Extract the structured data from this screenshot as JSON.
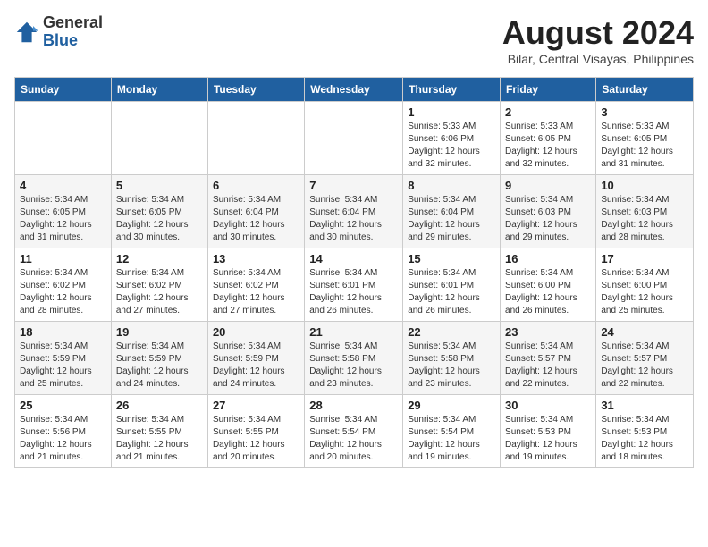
{
  "logo": {
    "text_general": "General",
    "text_blue": "Blue"
  },
  "header": {
    "month": "August 2024",
    "location": "Bilar, Central Visayas, Philippines"
  },
  "weekdays": [
    "Sunday",
    "Monday",
    "Tuesday",
    "Wednesday",
    "Thursday",
    "Friday",
    "Saturday"
  ],
  "weeks": [
    [
      {
        "day": "",
        "info": ""
      },
      {
        "day": "",
        "info": ""
      },
      {
        "day": "",
        "info": ""
      },
      {
        "day": "",
        "info": ""
      },
      {
        "day": "1",
        "info": "Sunrise: 5:33 AM\nSunset: 6:06 PM\nDaylight: 12 hours\nand 32 minutes."
      },
      {
        "day": "2",
        "info": "Sunrise: 5:33 AM\nSunset: 6:05 PM\nDaylight: 12 hours\nand 32 minutes."
      },
      {
        "day": "3",
        "info": "Sunrise: 5:33 AM\nSunset: 6:05 PM\nDaylight: 12 hours\nand 31 minutes."
      }
    ],
    [
      {
        "day": "4",
        "info": "Sunrise: 5:34 AM\nSunset: 6:05 PM\nDaylight: 12 hours\nand 31 minutes."
      },
      {
        "day": "5",
        "info": "Sunrise: 5:34 AM\nSunset: 6:05 PM\nDaylight: 12 hours\nand 30 minutes."
      },
      {
        "day": "6",
        "info": "Sunrise: 5:34 AM\nSunset: 6:04 PM\nDaylight: 12 hours\nand 30 minutes."
      },
      {
        "day": "7",
        "info": "Sunrise: 5:34 AM\nSunset: 6:04 PM\nDaylight: 12 hours\nand 30 minutes."
      },
      {
        "day": "8",
        "info": "Sunrise: 5:34 AM\nSunset: 6:04 PM\nDaylight: 12 hours\nand 29 minutes."
      },
      {
        "day": "9",
        "info": "Sunrise: 5:34 AM\nSunset: 6:03 PM\nDaylight: 12 hours\nand 29 minutes."
      },
      {
        "day": "10",
        "info": "Sunrise: 5:34 AM\nSunset: 6:03 PM\nDaylight: 12 hours\nand 28 minutes."
      }
    ],
    [
      {
        "day": "11",
        "info": "Sunrise: 5:34 AM\nSunset: 6:02 PM\nDaylight: 12 hours\nand 28 minutes."
      },
      {
        "day": "12",
        "info": "Sunrise: 5:34 AM\nSunset: 6:02 PM\nDaylight: 12 hours\nand 27 minutes."
      },
      {
        "day": "13",
        "info": "Sunrise: 5:34 AM\nSunset: 6:02 PM\nDaylight: 12 hours\nand 27 minutes."
      },
      {
        "day": "14",
        "info": "Sunrise: 5:34 AM\nSunset: 6:01 PM\nDaylight: 12 hours\nand 26 minutes."
      },
      {
        "day": "15",
        "info": "Sunrise: 5:34 AM\nSunset: 6:01 PM\nDaylight: 12 hours\nand 26 minutes."
      },
      {
        "day": "16",
        "info": "Sunrise: 5:34 AM\nSunset: 6:00 PM\nDaylight: 12 hours\nand 26 minutes."
      },
      {
        "day": "17",
        "info": "Sunrise: 5:34 AM\nSunset: 6:00 PM\nDaylight: 12 hours\nand 25 minutes."
      }
    ],
    [
      {
        "day": "18",
        "info": "Sunrise: 5:34 AM\nSunset: 5:59 PM\nDaylight: 12 hours\nand 25 minutes."
      },
      {
        "day": "19",
        "info": "Sunrise: 5:34 AM\nSunset: 5:59 PM\nDaylight: 12 hours\nand 24 minutes."
      },
      {
        "day": "20",
        "info": "Sunrise: 5:34 AM\nSunset: 5:59 PM\nDaylight: 12 hours\nand 24 minutes."
      },
      {
        "day": "21",
        "info": "Sunrise: 5:34 AM\nSunset: 5:58 PM\nDaylight: 12 hours\nand 23 minutes."
      },
      {
        "day": "22",
        "info": "Sunrise: 5:34 AM\nSunset: 5:58 PM\nDaylight: 12 hours\nand 23 minutes."
      },
      {
        "day": "23",
        "info": "Sunrise: 5:34 AM\nSunset: 5:57 PM\nDaylight: 12 hours\nand 22 minutes."
      },
      {
        "day": "24",
        "info": "Sunrise: 5:34 AM\nSunset: 5:57 PM\nDaylight: 12 hours\nand 22 minutes."
      }
    ],
    [
      {
        "day": "25",
        "info": "Sunrise: 5:34 AM\nSunset: 5:56 PM\nDaylight: 12 hours\nand 21 minutes."
      },
      {
        "day": "26",
        "info": "Sunrise: 5:34 AM\nSunset: 5:55 PM\nDaylight: 12 hours\nand 21 minutes."
      },
      {
        "day": "27",
        "info": "Sunrise: 5:34 AM\nSunset: 5:55 PM\nDaylight: 12 hours\nand 20 minutes."
      },
      {
        "day": "28",
        "info": "Sunrise: 5:34 AM\nSunset: 5:54 PM\nDaylight: 12 hours\nand 20 minutes."
      },
      {
        "day": "29",
        "info": "Sunrise: 5:34 AM\nSunset: 5:54 PM\nDaylight: 12 hours\nand 19 minutes."
      },
      {
        "day": "30",
        "info": "Sunrise: 5:34 AM\nSunset: 5:53 PM\nDaylight: 12 hours\nand 19 minutes."
      },
      {
        "day": "31",
        "info": "Sunrise: 5:34 AM\nSunset: 5:53 PM\nDaylight: 12 hours\nand 18 minutes."
      }
    ]
  ]
}
